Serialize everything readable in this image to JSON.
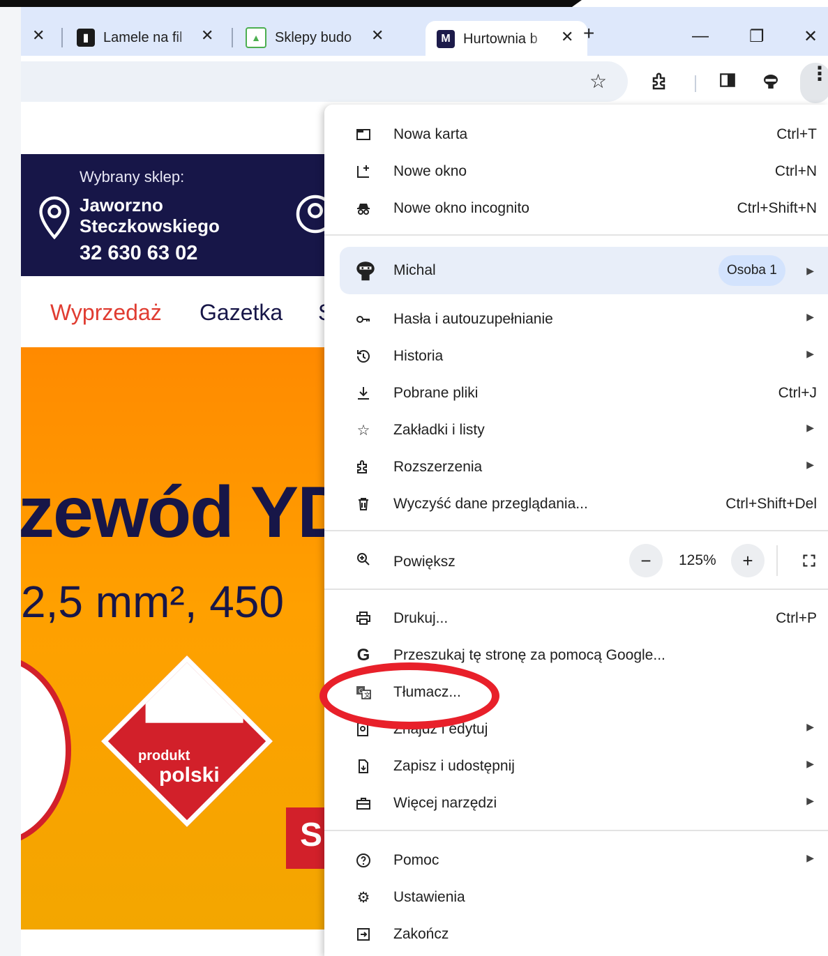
{
  "tabs": [
    {
      "title": "Lamele na fil",
      "favicon_color": "#1a1a1a",
      "favicon": "book-icon"
    },
    {
      "title": "Sklepy budo",
      "favicon_color": "#4caf50",
      "favicon": "sklepy-icon"
    },
    {
      "title": "Hurtownia b",
      "favicon_color": "#1d1b4a",
      "favicon_letter": "M",
      "active": true
    }
  ],
  "tab_controls": {
    "close": "✕",
    "new_tab": "+",
    "minimize": "—",
    "restore": "❐",
    "close_window": "✕"
  },
  "page": {
    "store_label": "Wybrany sklep:",
    "store_name_line1": "Jaworzno",
    "store_name_line2": "Steczkowskiego",
    "store_phone": "32 630 63 02",
    "nav": [
      "Wyprzedaż",
      "Gazetka",
      "S"
    ],
    "promo_title": "zewód YD",
    "promo_subtitle": "2,5 mm², 450",
    "badge_line1": "produkt",
    "badge_line2": "polski",
    "corner_letter": "S"
  },
  "menu": {
    "items": [
      {
        "label": "Nowa karta",
        "shortcut": "Ctrl+T",
        "icon": "new-tab-icon"
      },
      {
        "label": "Nowe okno",
        "shortcut": "Ctrl+N",
        "icon": "new-window-icon"
      },
      {
        "label": "Nowe okno incognito",
        "shortcut": "Ctrl+Shift+N",
        "icon": "incognito-icon"
      }
    ],
    "profile": {
      "name": "Michal",
      "badge": "Osoba 1"
    },
    "group2": [
      {
        "label": "Hasła i autouzupełnianie",
        "icon": "key-icon"
      },
      {
        "label": "Historia",
        "icon": "history-icon"
      },
      {
        "label": "Pobrane pliki",
        "shortcut": "Ctrl+J",
        "icon": "download-icon"
      },
      {
        "label": "Zakładki i listy",
        "icon": "star-icon"
      },
      {
        "label": "Rozszerzenia",
        "icon": "extension-icon"
      },
      {
        "label": "Wyczyść dane przeglądania...",
        "shortcut": "Ctrl+Shift+Del",
        "icon": "trash-icon"
      }
    ],
    "zoom": {
      "label": "Powiększ",
      "value": "125%",
      "minus": "−",
      "plus": "+"
    },
    "group3": [
      {
        "label": "Drukuj...",
        "shortcut": "Ctrl+P",
        "icon": "print-icon"
      },
      {
        "label": "Przeszukaj tę stronę za pomocą Google...",
        "icon": "google-icon"
      },
      {
        "label": "Tłumacz...",
        "icon": "translate-icon"
      },
      {
        "label": "Znajdź i edytuj",
        "icon": "find-edit-icon"
      },
      {
        "label": "Zapisz i udostępnij",
        "icon": "save-share-icon"
      },
      {
        "label": "Więcej narzędzi",
        "icon": "toolbox-icon"
      }
    ],
    "group4": [
      {
        "label": "Pomoc",
        "icon": "help-icon"
      },
      {
        "label": "Ustawienia",
        "icon": "settings-icon"
      },
      {
        "label": "Zakończ",
        "icon": "exit-icon"
      }
    ]
  },
  "highlight_color": "#e8202a"
}
